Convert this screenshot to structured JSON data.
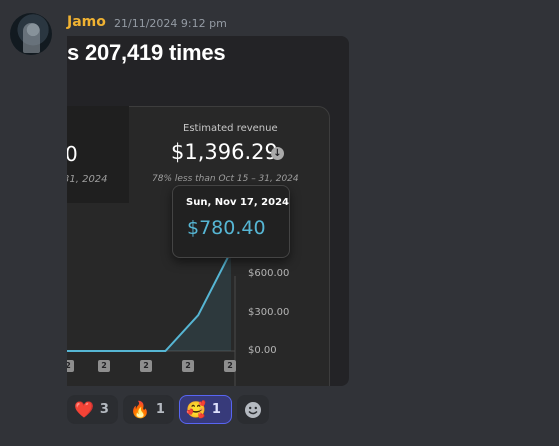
{
  "message": {
    "username": "Jamo",
    "timestamp": "21/11/2024 9:12 pm",
    "avatar_icon": "user-avatar"
  },
  "embed": {
    "title": "s 207,419 times",
    "left_panel": {
      "value": "0",
      "date": "31, 2024"
    },
    "metric": {
      "label": "Estimated revenue",
      "value": "$1,396.29",
      "icon": "arrow-down-circle-icon",
      "subtext": "78% less than Oct 15 – 31, 2024"
    },
    "tooltip": {
      "date": "Sun, Nov 17, 2024",
      "value": "$780.40"
    }
  },
  "chart_data": {
    "type": "area",
    "title": "",
    "xlabel": "",
    "ylabel": "",
    "y_ticks": [
      "$600.00",
      "$300.00",
      "$0.00"
    ],
    "x_tick_labels": [
      "2",
      "2",
      "2",
      "2",
      "2"
    ],
    "ylim": [
      0,
      900
    ],
    "series": [
      {
        "values": [
          0,
          0,
          0,
          0,
          280,
          780.4
        ]
      }
    ],
    "highlight_value": 780.4,
    "line_color": "#56b6d4"
  },
  "reactions": [
    {
      "emoji": "❤️",
      "name": "heart-reaction",
      "count": "3",
      "active": false
    },
    {
      "emoji": "🔥",
      "name": "fire-heart-reaction",
      "count": "1",
      "active": false
    },
    {
      "emoji": "🥰",
      "name": "smiling-hearts-reaction",
      "count": "1",
      "active": true
    }
  ],
  "add_reaction_icon": "add-reaction-icon",
  "colors": {
    "background": "#313338",
    "username": "#f0b232",
    "accent": "#5865f2",
    "chart_line": "#56b6d4"
  }
}
